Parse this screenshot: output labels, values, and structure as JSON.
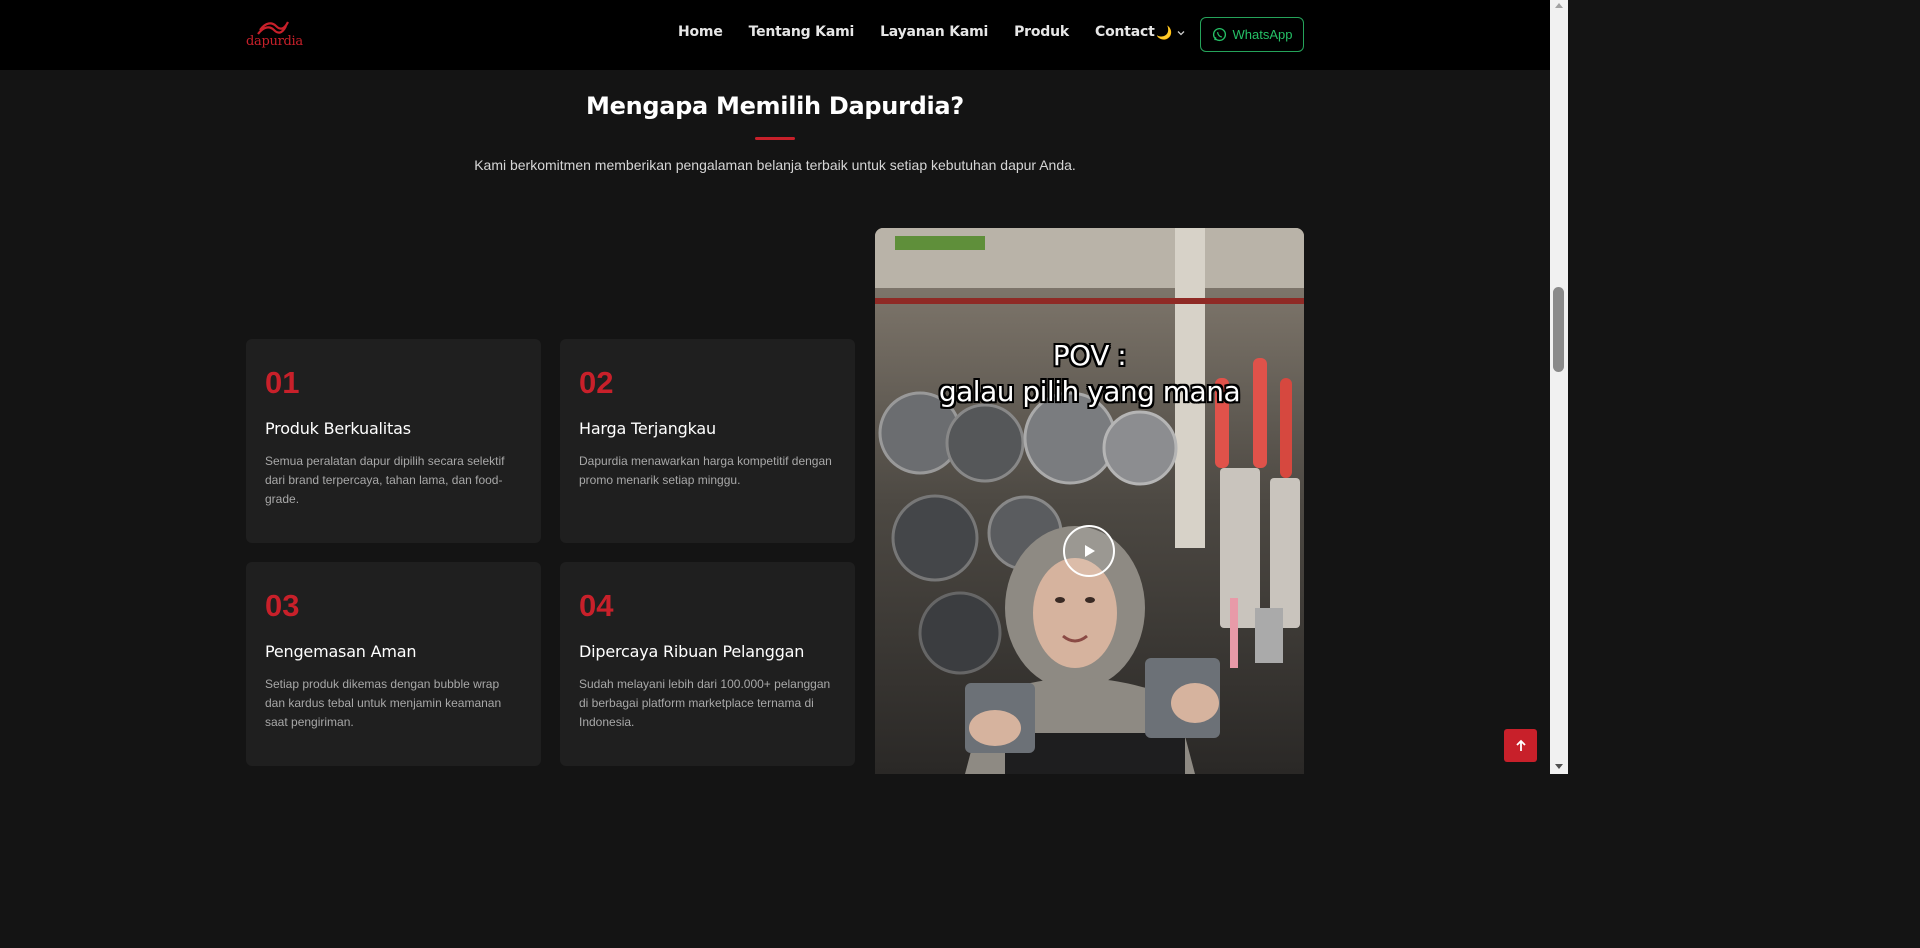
{
  "brand": {
    "name": "dapurdia",
    "accent": "#c8202a"
  },
  "nav": {
    "items": [
      "Home",
      "Tentang Kami",
      "Layanan Kami",
      "Produk",
      "Contact"
    ],
    "theme_icon": "moon-icon",
    "whatsapp_label": "WhatsApp"
  },
  "section": {
    "title": "Mengapa Memilih Dapurdia?",
    "subtitle": "Kami berkomitmen memberikan pengalaman belanja terbaik untuk setiap kebutuhan dapur Anda."
  },
  "features": [
    {
      "number": "01",
      "title": "Produk Berkualitas",
      "desc": "Semua peralatan dapur dipilih secara selektif dari brand terpercaya, tahan lama, dan food-grade."
    },
    {
      "number": "02",
      "title": "Harga Terjangkau",
      "desc": "Dapurdia menawarkan harga kompetitif dengan promo menarik setiap minggu."
    },
    {
      "number": "03",
      "title": "Pengemasan Aman",
      "desc": "Setiap produk dikemas dengan bubble wrap dan kardus tebal untuk menjamin keamanan saat pengiriman."
    },
    {
      "number": "04",
      "title": "Dipercaya Ribuan Pelanggan",
      "desc": "Sudah melayani lebih dari 100.000+ pelanggan di berbagai platform marketplace ternama di Indonesia."
    }
  ],
  "video": {
    "caption_line1": "POV :",
    "caption_line2": "galau pilih yang mana",
    "play_icon": "play-icon"
  },
  "back_to_top_icon": "arrow-up-icon"
}
